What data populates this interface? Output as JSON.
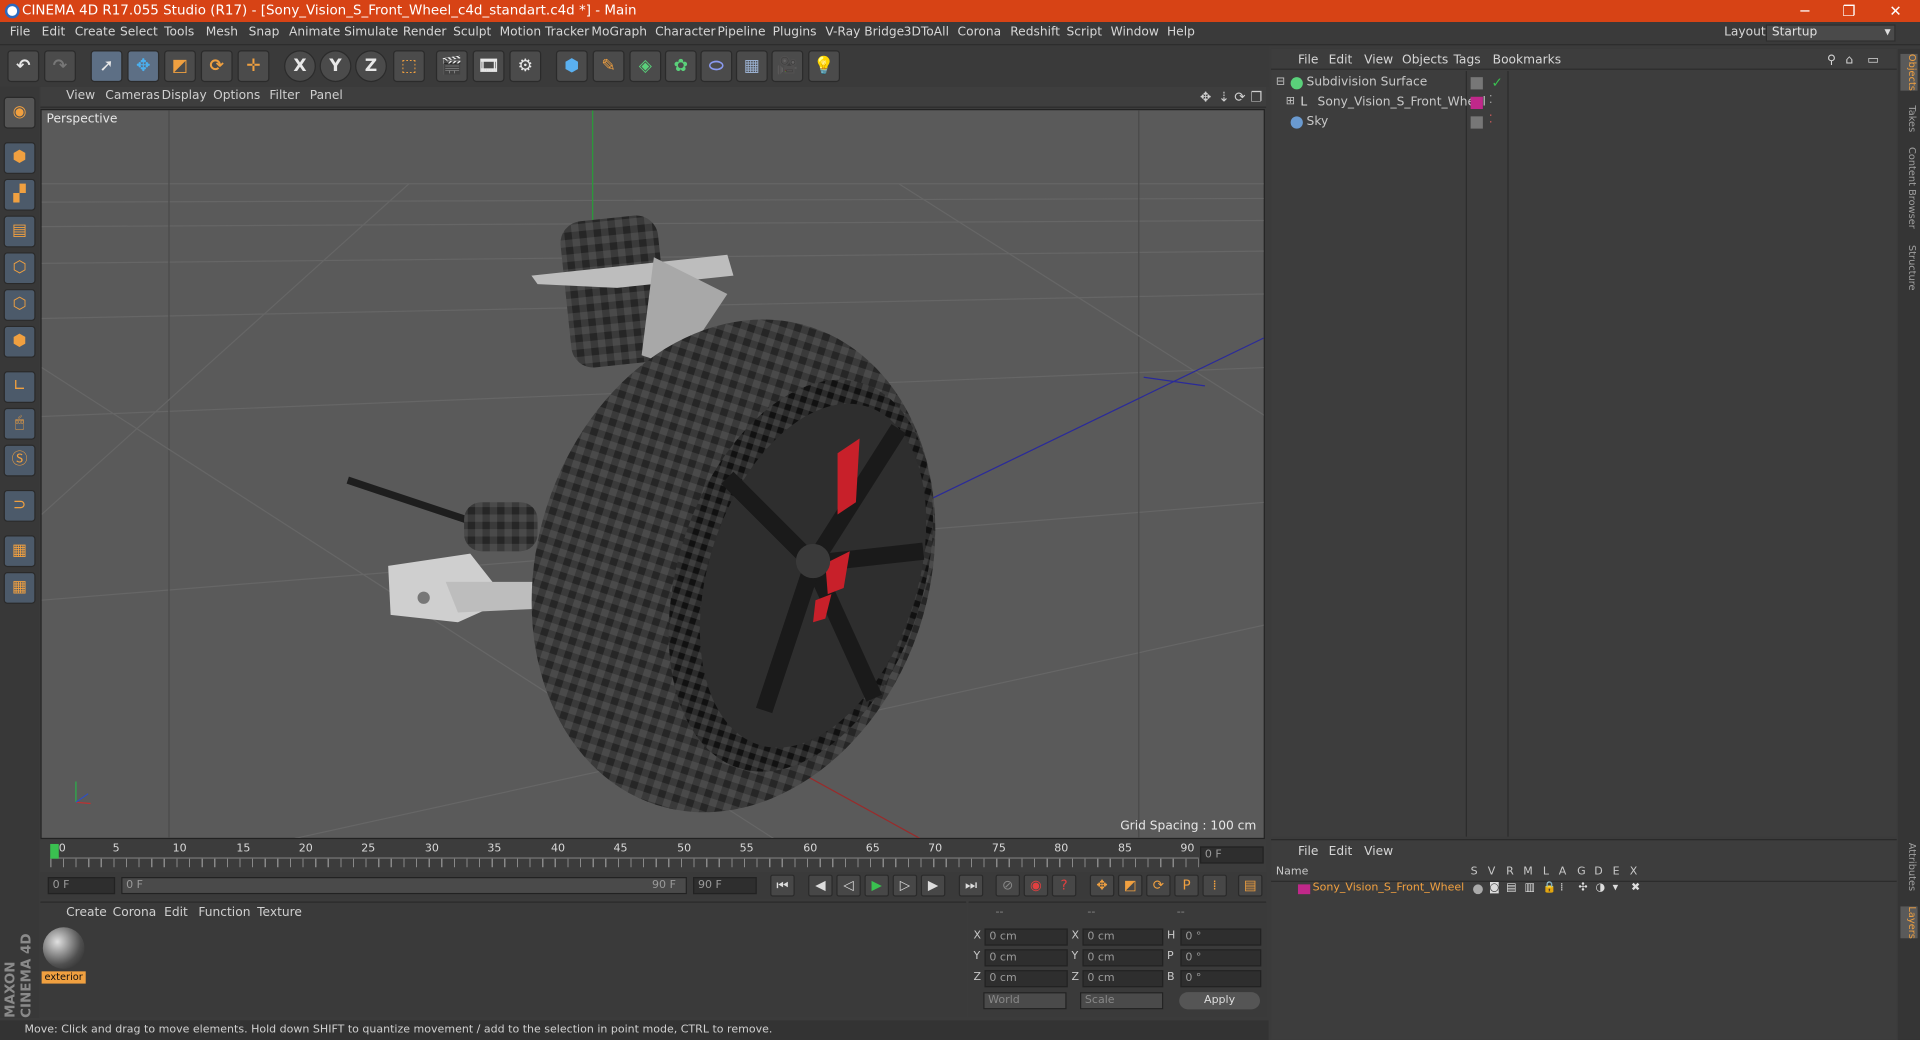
{
  "window": {
    "title": "CINEMA 4D R17.055 Studio (R17) - [Sony_Vision_S_Front_Wheel_c4d_standart.c4d *] - Main"
  },
  "menubar": {
    "items": [
      "File",
      "Edit",
      "Create",
      "Select",
      "Tools",
      "Mesh",
      "Snap",
      "Animate",
      "Simulate",
      "Render",
      "Sculpt",
      "Motion Tracker",
      "MoGraph",
      "Character",
      "Pipeline",
      "Plugins",
      "V-Ray Bridge",
      "3DToAll",
      "Corona",
      "Redshift",
      "Script",
      "Window",
      "Help"
    ],
    "layout_label": "Layout:",
    "layout_value": "Startup"
  },
  "toolbar": {
    "axis_x": "X",
    "axis_y": "Y",
    "axis_z": "Z"
  },
  "viewport": {
    "menu": [
      "View",
      "Cameras",
      "Display",
      "Options",
      "Filter",
      "Panel"
    ],
    "camera_label": "Perspective",
    "grid_spacing": "Grid Spacing : 100 cm"
  },
  "timeline": {
    "ticks": [
      "0",
      "5",
      "10",
      "15",
      "20",
      "25",
      "30",
      "35",
      "40",
      "45",
      "50",
      "55",
      "60",
      "65",
      "70",
      "75",
      "80",
      "85",
      "90"
    ],
    "current_frame": "0 F",
    "start_field": "0 F",
    "range_start": "0 F",
    "range_end": "90 F",
    "end_field": "90 F"
  },
  "material_panel": {
    "menu": [
      "Create",
      "Corona",
      "Edit",
      "Function",
      "Texture"
    ],
    "material_name": "exterior"
  },
  "coordinates": {
    "header": [
      "--",
      "--",
      "--"
    ],
    "rows": [
      {
        "a": "X",
        "av": "0 cm",
        "b": "X",
        "bv": "0 cm",
        "c": "H",
        "cv": "0 °"
      },
      {
        "a": "Y",
        "av": "0 cm",
        "b": "Y",
        "bv": "0 cm",
        "c": "P",
        "cv": "0 °"
      },
      {
        "a": "Z",
        "av": "0 cm",
        "b": "Z",
        "bv": "0 cm",
        "c": "B",
        "cv": "0 °"
      }
    ],
    "world": "World",
    "scale": "Scale",
    "apply": "Apply"
  },
  "object_manager": {
    "menu": [
      "File",
      "Edit",
      "View",
      "Objects",
      "Tags",
      "Bookmarks"
    ],
    "objects": [
      "Subdivision Surface",
      "Sony_Vision_S_Front_Wheel",
      "Sky"
    ]
  },
  "layer_manager": {
    "menu": [
      "File",
      "Edit",
      "View"
    ],
    "columns": [
      "Name",
      "S",
      "V",
      "R",
      "M",
      "L",
      "A",
      "G",
      "D",
      "E",
      "X"
    ],
    "layer_name": "Sony_Vision_S_Front_Wheel"
  },
  "right_tabs": [
    "Objects",
    "Takes",
    "Content Browser",
    "Structure",
    "Attributes",
    "Layers"
  ],
  "brand": "MAXON CINEMA 4D",
  "status": "Move: Click and drag to move elements. Hold down SHIFT to quantize movement / add to the selection in point mode, CTRL to remove.",
  "colors": {
    "titlebar": "#d74315",
    "accent": "#f0a040",
    "layer": "#c0288a"
  }
}
